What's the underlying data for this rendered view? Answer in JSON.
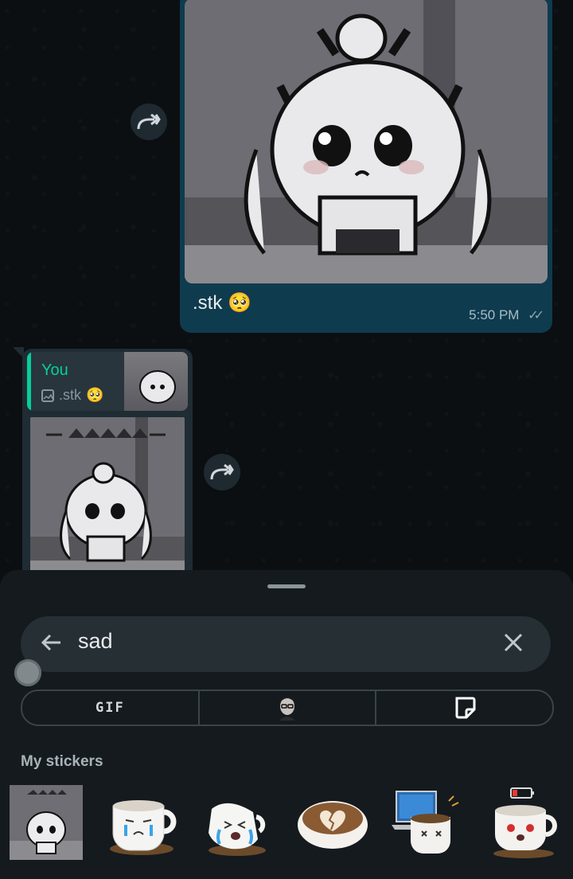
{
  "chat": {
    "outgoing": {
      "caption_text": ".stk",
      "caption_emoji": "🥺",
      "time": "5:50 PM"
    },
    "incoming": {
      "reply_author": "You",
      "reply_text": ".stk",
      "reply_emoji": "🥺"
    }
  },
  "sticker_panel": {
    "search": {
      "query": "sad"
    },
    "tabs": [
      {
        "label": "GIF",
        "icon": "gif-icon"
      },
      {
        "label": "",
        "icon": "avatar-icon"
      },
      {
        "label": "",
        "icon": "sticker-icon"
      }
    ],
    "section_title": "My stickers",
    "stickers": [
      "anime-girl-sticker",
      "crying-cup-sticker",
      "sobbing-cup-sticker",
      "broken-heart-coffee-sticker",
      "laptop-cup-sticker",
      "low-battery-cup-sticker"
    ]
  },
  "colors": {
    "accent_green": "#06cf9c",
    "outgoing_bubble": "#0f3b4f",
    "incoming_bubble": "#1f2c33",
    "sheet_bg": "#141a1e"
  }
}
